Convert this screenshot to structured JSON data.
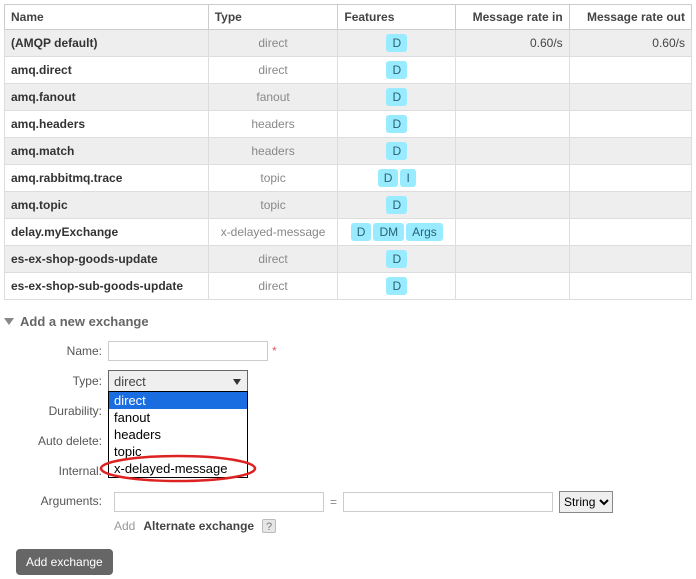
{
  "columns": {
    "name": "Name",
    "type": "Type",
    "features": "Features",
    "rate_in": "Message rate in",
    "rate_out": "Message rate out"
  },
  "exchanges": [
    {
      "name": "(AMQP default)",
      "type": "direct",
      "features": [
        "D"
      ],
      "rate_in": "0.60/s",
      "rate_out": "0.60/s"
    },
    {
      "name": "amq.direct",
      "type": "direct",
      "features": [
        "D"
      ],
      "rate_in": "",
      "rate_out": ""
    },
    {
      "name": "amq.fanout",
      "type": "fanout",
      "features": [
        "D"
      ],
      "rate_in": "",
      "rate_out": ""
    },
    {
      "name": "amq.headers",
      "type": "headers",
      "features": [
        "D"
      ],
      "rate_in": "",
      "rate_out": ""
    },
    {
      "name": "amq.match",
      "type": "headers",
      "features": [
        "D"
      ],
      "rate_in": "",
      "rate_out": ""
    },
    {
      "name": "amq.rabbitmq.trace",
      "type": "topic",
      "features": [
        "D",
        "I"
      ],
      "rate_in": "",
      "rate_out": ""
    },
    {
      "name": "amq.topic",
      "type": "topic",
      "features": [
        "D"
      ],
      "rate_in": "",
      "rate_out": ""
    },
    {
      "name": "delay.myExchange",
      "type": "x-delayed-message",
      "features": [
        "D",
        "DM",
        "Args"
      ],
      "rate_in": "",
      "rate_out": ""
    },
    {
      "name": "es-ex-shop-goods-update",
      "type": "direct",
      "features": [
        "D"
      ],
      "rate_in": "",
      "rate_out": ""
    },
    {
      "name": "es-ex-shop-sub-goods-update",
      "type": "direct",
      "features": [
        "D"
      ],
      "rate_in": "",
      "rate_out": ""
    }
  ],
  "section_title": "Add a new exchange",
  "form": {
    "labels": {
      "name": "Name:",
      "type": "Type:",
      "durability": "Durability:",
      "auto_delete": "Auto delete:",
      "internal": "Internal:",
      "arguments": "Arguments:"
    },
    "type_selected": "direct",
    "type_options": [
      "direct",
      "fanout",
      "headers",
      "topic",
      "x-delayed-message"
    ],
    "arg_type_selected": "String",
    "add_label": "Add",
    "alt_exchange_label": "Alternate exchange",
    "submit_label": "Add exchange",
    "help_glyph": "?"
  },
  "annotation": {
    "highlight_option": "x-delayed-message"
  }
}
